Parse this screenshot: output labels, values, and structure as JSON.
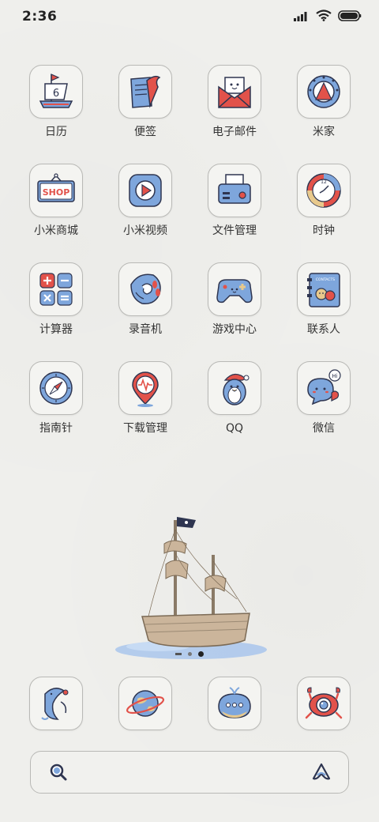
{
  "status": {
    "time": "2:36"
  },
  "apps": [
    {
      "name": "app-calendar",
      "label": "日历",
      "icon": "sailboat-calendar-icon",
      "glyph": "6"
    },
    {
      "name": "app-notes",
      "label": "便签",
      "icon": "notes-flag-icon"
    },
    {
      "name": "app-email",
      "label": "电子邮件",
      "icon": "envelope-icon"
    },
    {
      "name": "app-mijia",
      "label": "米家",
      "icon": "mijia-icon"
    },
    {
      "name": "app-mi-store",
      "label": "小米商城",
      "icon": "shop-sign-icon",
      "glyph": "SHOP"
    },
    {
      "name": "app-mi-video",
      "label": "小米视频",
      "icon": "play-icon"
    },
    {
      "name": "app-file-manager",
      "label": "文件管理",
      "icon": "printer-icon"
    },
    {
      "name": "app-clock",
      "label": "时钟",
      "icon": "clock-icon",
      "glyph": "12"
    },
    {
      "name": "app-calculator",
      "label": "计算器",
      "icon": "calculator-icon"
    },
    {
      "name": "app-recorder",
      "label": "录音机",
      "icon": "shell-recorder-icon"
    },
    {
      "name": "app-game-center",
      "label": "游戏中心",
      "icon": "gamepad-icon"
    },
    {
      "name": "app-contacts",
      "label": "联系人",
      "icon": "contacts-book-icon",
      "glyph": "CONTACTS"
    },
    {
      "name": "app-compass",
      "label": "指南针",
      "icon": "compass-icon"
    },
    {
      "name": "app-downloads",
      "label": "下载管理",
      "icon": "download-pin-icon"
    },
    {
      "name": "app-qq",
      "label": "QQ",
      "icon": "penguin-icon"
    },
    {
      "name": "app-wechat",
      "label": "微信",
      "icon": "chat-bubbles-icon",
      "glyph": "Hi"
    }
  ],
  "dock": [
    {
      "name": "dock-phone",
      "icon": "phone-whale-icon"
    },
    {
      "name": "dock-browser",
      "icon": "planet-icon"
    },
    {
      "name": "dock-messages",
      "icon": "whale-chat-icon"
    },
    {
      "name": "dock-camera",
      "icon": "crab-camera-icon"
    }
  ],
  "search": {
    "left_icon": "search-icon",
    "right_icon": "assistant-icon"
  },
  "colors": {
    "blue": "#7ea6dc",
    "red": "#e2524a",
    "outline": "#2e3550",
    "beige": "#cbb59b"
  }
}
